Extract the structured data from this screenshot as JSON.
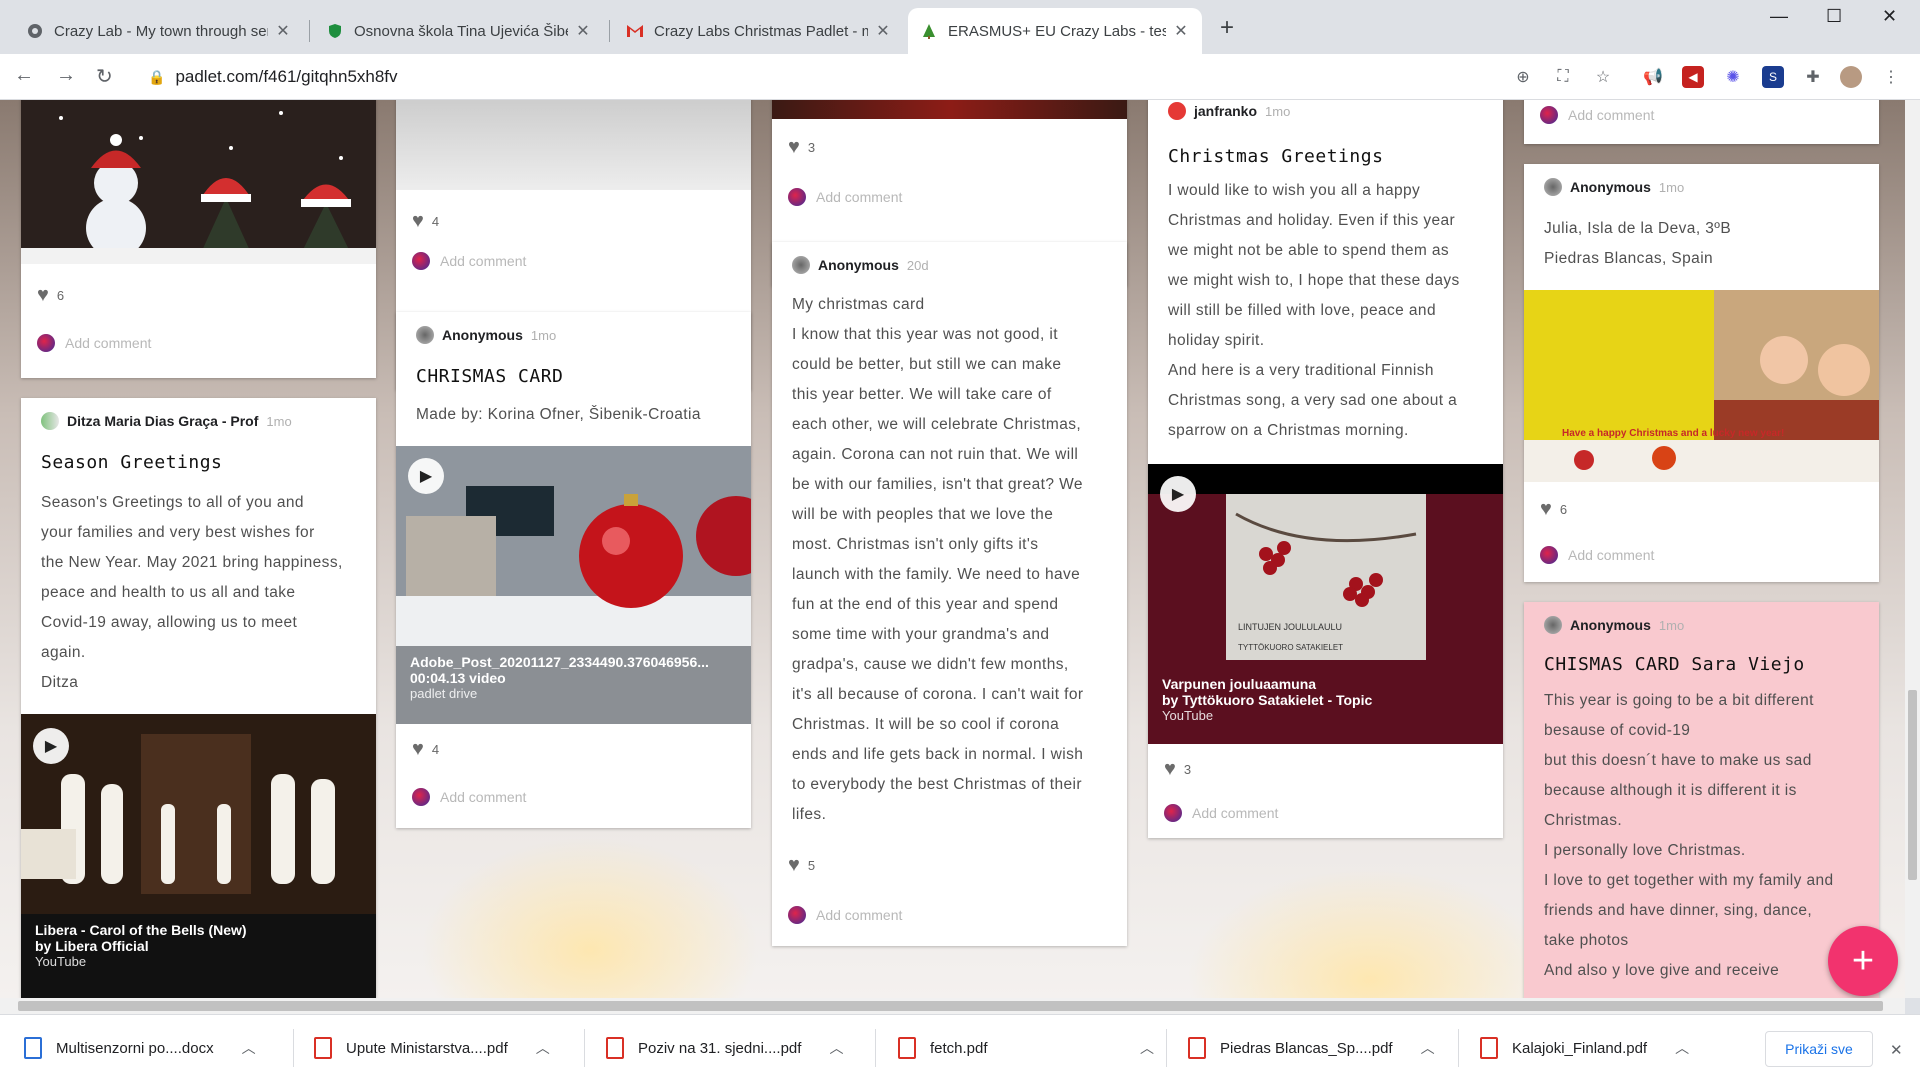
{
  "tabs": [
    {
      "title": "Crazy Lab - My town through sens",
      "icon": "page-icon",
      "active": false
    },
    {
      "title": "Osnovna škola Tina Ujevića Šiben",
      "icon": "shield-icon",
      "active": false
    },
    {
      "title": "Crazy Labs Christmas Padlet - ma",
      "icon": "gmail-icon",
      "active": false
    },
    {
      "title": "ERASMUS+ EU Crazy Labs - testi",
      "icon": "padlet-tree-icon",
      "active": true
    }
  ],
  "address_bar": {
    "url": "padlet.com/f461/gitqhn5xh8fv"
  },
  "colors": {
    "accent": "#f2336e",
    "pink_card": "#f9c9cf",
    "caption_maroon": "#5b0f1f"
  },
  "common": {
    "add_comment": "Add comment"
  },
  "col1": {
    "top_likes": "6",
    "card": {
      "author": "Ditza Maria Dias Graça - Prof",
      "time": "1mo",
      "title": "Season Greetings",
      "body": [
        "Season's Greetings to all of you and",
        "your families and very best wishes for",
        "the New Year. May 2021 bring happiness,",
        "peace and health to us all and take",
        "Covid-19 away, allowing us to meet",
        "again.",
        "Ditza"
      ],
      "video": {
        "title": "Libera - Carol of the Bells (New)",
        "channel": "by Libera Official",
        "source": "YouTube"
      }
    }
  },
  "col2": {
    "top_likes": "4",
    "card": {
      "author": "Anonymous",
      "time": "1mo",
      "title": "CHRISMAS CARD",
      "subtitle": "Made by: Korina Ofner, Šibenik-Croatia",
      "video": {
        "title": "Adobe_Post_20201127_2334490.376046956...",
        "meta": "00:04.13 video",
        "source": "padlet drive"
      },
      "likes": "4"
    }
  },
  "col3": {
    "top_likes": "3",
    "card": {
      "author": "Anonymous",
      "time": "20d",
      "body": [
        "My christmas card",
        "I know that this year was not good, it",
        "could be better, but still we can make",
        "this year better. We will take care of",
        "each other, we will celebrate Christmas,",
        "again. Corona can not ruin that. We will",
        "be with our families, isn't that great? We",
        "will be with peoples that we love the",
        "most. Christmas isn't only gifts it's",
        "launch with the family. We need to have",
        "fun at the end of this year and spend",
        "some time with your grandma's and",
        "gradpa's, cause we didn't few months,",
        "it's all because of corona. I can't wait for",
        "Christmas. It will be so cool if corona",
        "ends and life gets back in normal. I wish",
        "to everybody the best Christmas of their",
        "lifes."
      ],
      "likes": "5"
    }
  },
  "col4": {
    "card": {
      "author": "janfranko",
      "time": "1mo",
      "title": "Christmas Greetings",
      "body": [
        "I would like to wish you all a happy",
        "Christmas and holiday. Even if this year",
        "we might not be able to spend them as",
        "we might wish to, I hope that these days",
        "will still be filled with love, peace and",
        "holiday spirit.",
        "And here is a very traditional Finnish",
        "Christmas song, a very sad one about a",
        "sparrow on a Christmas morning."
      ],
      "video": {
        "title": "Varpunen jouluaamuna",
        "channel": "by Tyttökuoro Satakielet - Topic",
        "source": "YouTube",
        "thumb_text_1": "LINTUJEN JOULULAULU",
        "thumb_text_2": "TYTTÖKUORO SATAKIELET"
      },
      "likes": "3"
    }
  },
  "col5": {
    "card1": {
      "author": "Anonymous",
      "time": "1mo",
      "body": [
        "Julia, Isla de la Deva, 3ºB",
        "Piedras Blancas, Spain"
      ],
      "image_caption": "Have a happy Christmas and a lucky new year!",
      "likes": "6"
    },
    "card2": {
      "author": "Anonymous",
      "time": "1mo",
      "title": "CHISMAS CARD Sara Viejo",
      "body": [
        "This year is going to be a bit different",
        "besause of covid-19",
        "but this doesn´t have to make us sad",
        "because although it is different it is",
        "Christmas.",
        "I personally love Christmas.",
        "I love to get together with my family and",
        "friends and have dinner, sing, dance,",
        "take photos",
        "And also y love give and receive"
      ]
    }
  },
  "downloads": {
    "items": [
      {
        "name": "Multisenzorni po....docx",
        "type": "word"
      },
      {
        "name": "Upute Ministarstva....pdf",
        "type": "pdf"
      },
      {
        "name": "Poziv na 31. sjedni....pdf",
        "type": "pdf"
      },
      {
        "name": "fetch.pdf",
        "type": "pdf"
      },
      {
        "name": "Piedras Blancas_Sp....pdf",
        "type": "pdf"
      },
      {
        "name": "Kalajoki_Finland.pdf",
        "type": "pdf"
      }
    ],
    "show_all": "Prikaži sve"
  }
}
